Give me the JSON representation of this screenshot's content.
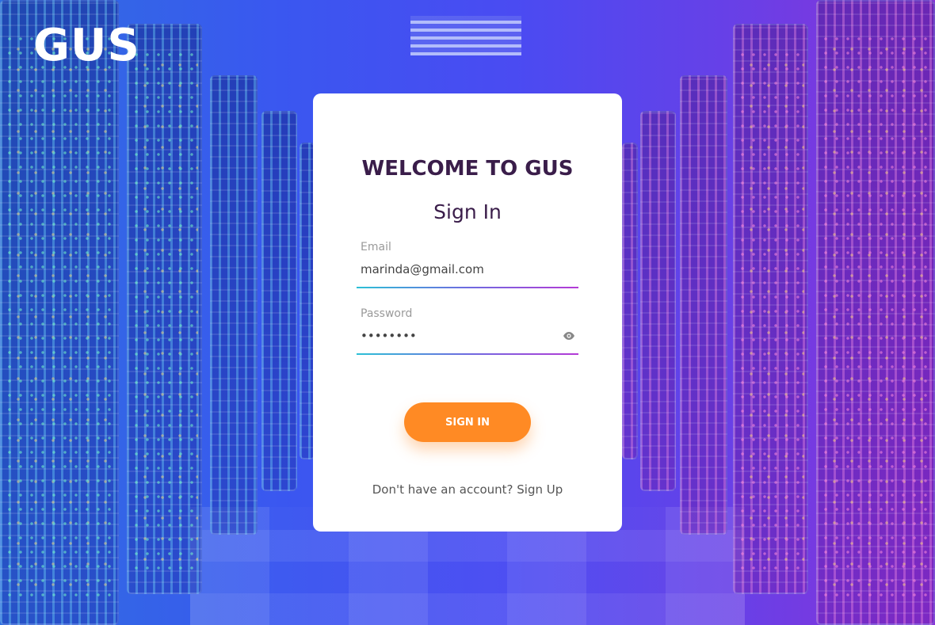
{
  "brand": {
    "logo_text": "GUS"
  },
  "card": {
    "welcome": "WELCOME TO GUS",
    "title": "Sign In",
    "email": {
      "label": "Email",
      "value": "marinda@gmail.com"
    },
    "password": {
      "label": "Password",
      "value": "••••••••",
      "toggle_icon": "eye-icon"
    },
    "submit_label": "SIGN IN",
    "signup_prompt": "Don't have an account?",
    "signup_link": "Sign Up"
  },
  "colors": {
    "accent_button": "#ff8a24",
    "title_text": "#3a1d4a",
    "underline_start": "#2cc0d6",
    "underline_end": "#b43ad6"
  }
}
